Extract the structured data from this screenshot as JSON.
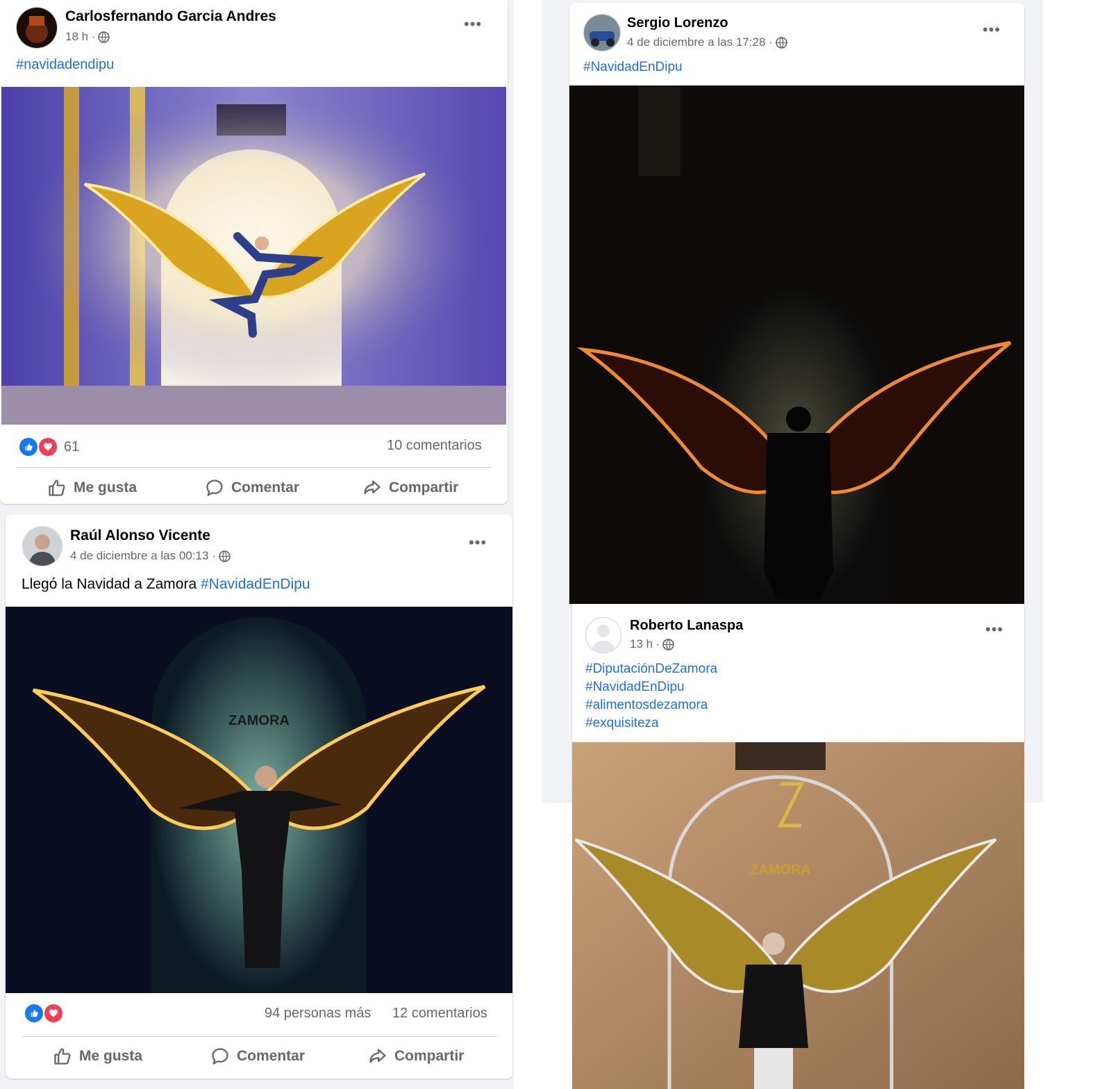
{
  "posts": [
    {
      "author": "Carlosfernando Garcia Andres",
      "time": "18 h ·",
      "hashtags": [
        "#navidadendipu"
      ],
      "reaction_count": "61",
      "comments": "10 comentarios",
      "actions": {
        "like": "Me gusta",
        "comment": "Comentar",
        "share": "Compartir"
      },
      "more": "•••"
    },
    {
      "author": "Sergio Lorenzo",
      "time": "4 de diciembre a las 17:28 ·",
      "hashtags": [
        "#NavidadEnDipu"
      ],
      "more": "•••"
    },
    {
      "author": "Raúl Alonso Vicente",
      "time": "4 de diciembre a las 00:13 ·",
      "text": "Llegó la Navidad a Zamora",
      "hashtags": [
        "#NavidadEnDipu"
      ],
      "others": "94 personas más",
      "comments": "12 comentarios",
      "actions": {
        "like": "Me gusta",
        "comment": "Comentar",
        "share": "Compartir"
      },
      "more": "•••"
    },
    {
      "author": "Roberto Lanaspa",
      "time": "13 h ·",
      "hashtags": [
        "#DiputaciónDeZamora",
        "#NavidadEnDipu",
        "#alimentosdezamora",
        "#exquisiteza"
      ],
      "more": "•••"
    }
  ],
  "colors": {
    "hashtag": "#216fdb",
    "like": "#1877f2",
    "love": "#f33e58",
    "muted": "#65676b",
    "background": "#f0f2f5"
  },
  "icons": [
    "globe-icon",
    "more-options-icon",
    "like-icon",
    "comment-icon",
    "share-icon",
    "like-reaction-icon",
    "love-reaction-icon"
  ]
}
